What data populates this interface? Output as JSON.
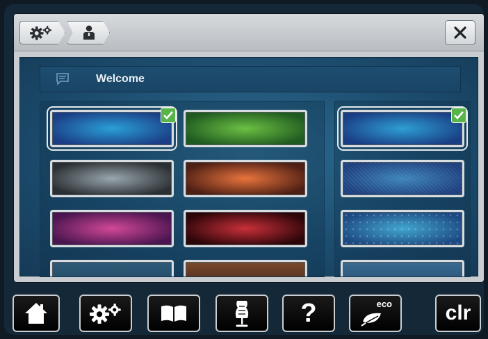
{
  "breadcrumb": [
    {
      "icon": "gears-icon"
    },
    {
      "icon": "user-icon"
    }
  ],
  "close_icon": "close-icon",
  "welcome": {
    "icon": "message-icon",
    "text": "Welcome"
  },
  "themes_left": [
    {
      "name": "blue",
      "selected": true,
      "colors": [
        "#2a9fd6",
        "#1b3f86"
      ]
    },
    {
      "name": "green",
      "selected": false,
      "colors": [
        "#6cc043",
        "#1f5a20"
      ]
    },
    {
      "name": "gray",
      "selected": false,
      "colors": [
        "#9aa7ae",
        "#2a2f33"
      ]
    },
    {
      "name": "orange",
      "selected": false,
      "colors": [
        "#e8743d",
        "#4e1f14"
      ]
    },
    {
      "name": "magenta",
      "selected": false,
      "colors": [
        "#d24896",
        "#4a1550"
      ]
    },
    {
      "name": "red",
      "selected": false,
      "colors": [
        "#c8303a",
        "#2b0508"
      ]
    }
  ],
  "themes_right": [
    {
      "name": "blue",
      "selected": true,
      "colors": [
        "#2e9fd4",
        "#1a3e84"
      ]
    },
    {
      "name": "blue-texture",
      "selected": false,
      "colors": [
        "#3c84bb",
        "#1c3e7d"
      ]
    },
    {
      "name": "blue-dots",
      "selected": false,
      "colors": [
        "#41a6cf",
        "#1e4a83"
      ]
    }
  ],
  "bottom_buttons": [
    {
      "id": "home",
      "icon": "home-icon"
    },
    {
      "id": "settings",
      "icon": "gears-icon"
    },
    {
      "id": "guide",
      "icon": "book-icon"
    },
    {
      "id": "sewing",
      "icon": "dress-form-icon"
    },
    {
      "id": "help",
      "text": "?"
    },
    {
      "id": "eco",
      "text": "eco",
      "icon": "leaf-icon"
    },
    {
      "id": "clear",
      "text": "clr"
    }
  ]
}
